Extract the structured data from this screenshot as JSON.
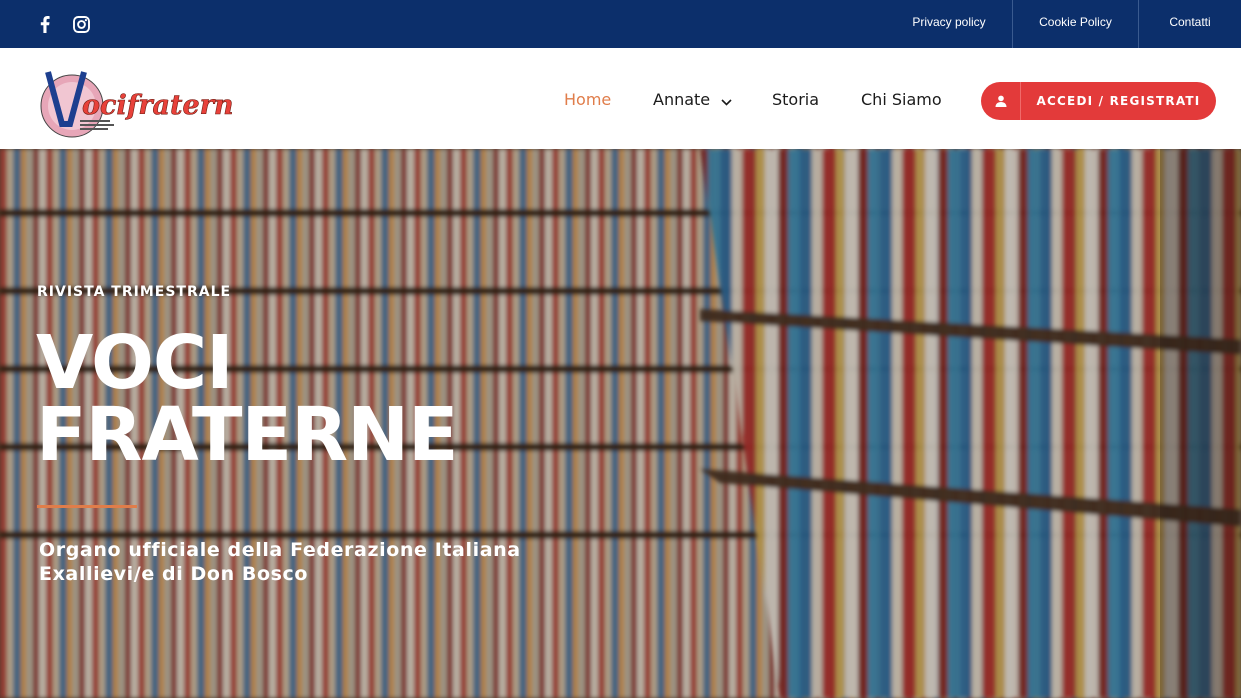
{
  "topbar": {
    "social": {
      "facebook_icon": "facebook-icon",
      "instagram_icon": "instagram-icon"
    },
    "links": [
      "Privacy policy",
      "Cookie Policy",
      "Contatti"
    ]
  },
  "header": {
    "logo_alt": "Voci fraterne",
    "nav": [
      {
        "label": "Home",
        "active": true
      },
      {
        "label": "Annate",
        "has_dropdown": true
      },
      {
        "label": "Storia"
      },
      {
        "label": "Chi Siamo"
      }
    ],
    "login": {
      "label": "ACCEDI / REGISTRATI",
      "icon": "user-icon"
    }
  },
  "hero": {
    "kicker": "RIVISTA TRIMESTRALE",
    "title_line1": "VOCI",
    "title_line2": "FRATERNE",
    "subtitle_line1": "Organo ufficiale della Federazione Italiana",
    "subtitle_line2": "Exallievi/e di Don Bosco",
    "background": "library-bookshelves-image"
  },
  "colors": {
    "topbar": "#0c2f6b",
    "accent": "#e07d4a",
    "button": "#e33a3a"
  }
}
